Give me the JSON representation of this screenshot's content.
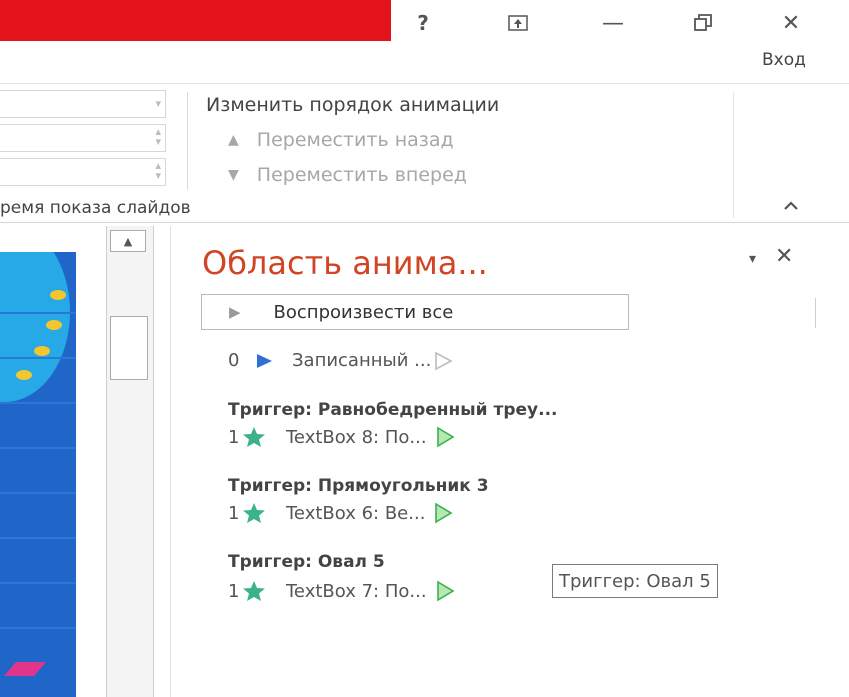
{
  "window": {
    "help_label": "?",
    "ribbon_display_label": "⬆",
    "minimize_label": "—",
    "restore_label": "🗗",
    "close_label": "✕",
    "signin_label": "Вход",
    "brand_color": "#e3121b"
  },
  "ribbon": {
    "reorder_title": "Изменить порядок анимации",
    "move_back_label": "Переместить назад",
    "move_forward_label": "Переместить вперед",
    "group_label": "ремя показа слайдов",
    "collapse_label": "^"
  },
  "pane": {
    "title": "Область анима...",
    "title_color": "#d14524",
    "menu_icon": "▾",
    "close_icon": "✕",
    "play_all_label": "Воспроизвести все",
    "items": [
      {
        "num": "0",
        "icon": "play-icon",
        "label": "Записанный ...",
        "timeline": "outline"
      },
      {
        "trigger": "Триггер: Равнобедренный треу...",
        "num": "1",
        "icon": "star-icon",
        "label": "TextBox 8: По...",
        "timeline": "green"
      },
      {
        "trigger": "Триггер: Прямоугольник 3",
        "num": "1",
        "icon": "star-icon",
        "label": "TextBox 6: Ве...",
        "timeline": "green"
      },
      {
        "trigger": "Триггер: Овал 5",
        "num": "1",
        "icon": "star-icon",
        "label": "TextBox 7: По...",
        "timeline": "green"
      }
    ],
    "tooltip": "Триггер: Овал 5"
  },
  "colors": {
    "star": "#3bb38a",
    "play": "#2f6fd6",
    "timeline_green": "#36b34a"
  }
}
